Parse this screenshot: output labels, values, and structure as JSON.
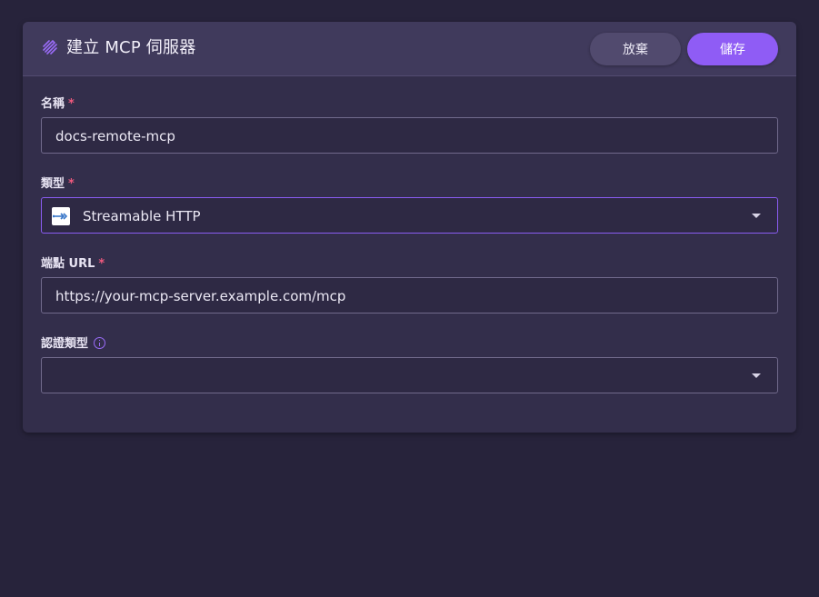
{
  "header": {
    "title": "建立 MCP 伺服器",
    "cancel_label": "放棄",
    "save_label": "儲存"
  },
  "form": {
    "name": {
      "label": "名稱",
      "required_mark": "*",
      "value": "docs-remote-mcp"
    },
    "type": {
      "label": "類型",
      "required_mark": "*",
      "selected": "Streamable HTTP",
      "icon": "streamable-http-icon"
    },
    "endpoint": {
      "label": "端點 URL",
      "required_mark": "*",
      "value": "https://your-mcp-server.example.com/mcp"
    },
    "auth_type": {
      "label": "認證類型",
      "selected": "",
      "icon": "info-icon"
    }
  },
  "colors": {
    "accent": "#8f5cf5",
    "required": "#f05a7e",
    "background": "#27233b",
    "card": "#332e4b",
    "header": "#403a5c"
  }
}
